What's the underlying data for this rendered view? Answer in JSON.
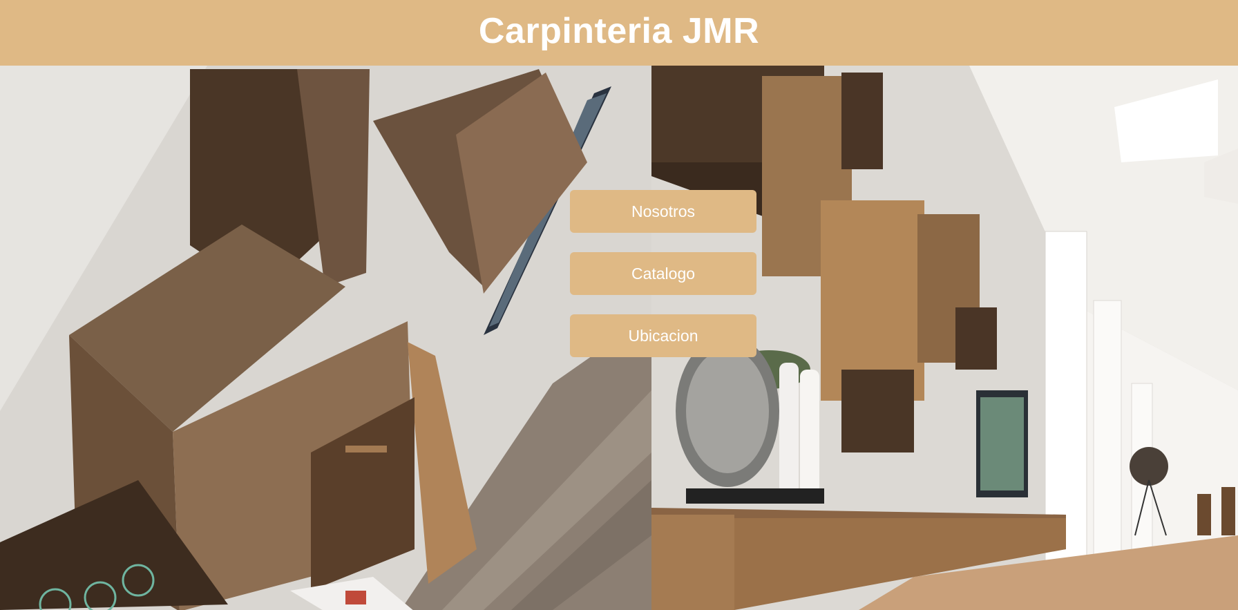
{
  "header": {
    "title": "Carpinteria JMR"
  },
  "nav": {
    "buttons": [
      {
        "label": "Nosotros"
      },
      {
        "label": "Catalogo"
      },
      {
        "label": "Ubicacion"
      }
    ]
  },
  "theme": {
    "accent": "#dfb985",
    "text_on_accent": "#ffffff"
  },
  "images": [
    {
      "name": "hero-image-left",
      "description": "wall-mounted wooden cabinets"
    },
    {
      "name": "hero-image-right",
      "description": "wooden shelving room interior"
    }
  ]
}
